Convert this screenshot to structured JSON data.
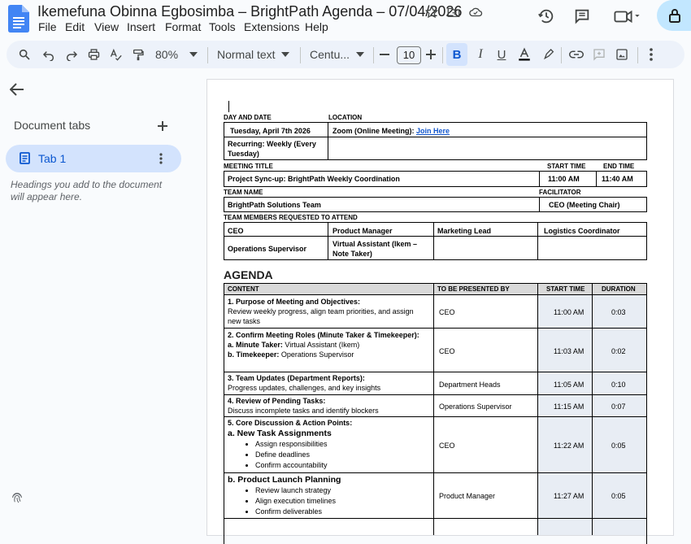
{
  "doc": {
    "title": "Ikemefuna Obinna Egbosimba – BrightPath Agenda – 07/04/2026",
    "menu": [
      "File",
      "Edit",
      "View",
      "Insert",
      "Format",
      "Tools",
      "Extensions",
      "Help"
    ]
  },
  "toolbar": {
    "zoom": "80%",
    "style": "Normal text",
    "font": "Centu...",
    "font_size": "10"
  },
  "sidebar": {
    "section_label": "Document tabs",
    "tab_label": "Tab 1",
    "hint": "Headings you add to the document will appear here."
  },
  "form": {
    "day_date_label": "DAY AND DATE",
    "location_label": "LOCATION",
    "date_value": "Tuesday, April 7th 2026",
    "location_value": "Zoom (Online Meeting):",
    "location_link": "Join Here",
    "recurring": "Recurring: Weekly (Every Tuesday)",
    "meeting_title_label": "MEETING TITLE",
    "start_time_label": "START TIME",
    "end_time_label": "END TIME",
    "meeting_title": "Project Sync-up: BrightPath Weekly Coordination",
    "start_time": "11:00 AM",
    "end_time": "11:40 AM",
    "team_name_label": "TEAM NAME",
    "facilitator_label": "FACILITATOR",
    "team_name": "BrightPath Solutions Team",
    "facilitator": "CEO (Meeting Chair)",
    "members_label": "TEAM MEMBERS REQUESTED TO ATTEND",
    "members": [
      "CEO",
      "Product Manager",
      "Marketing Lead",
      "Logistics Coordinator",
      "Operations Supervisor",
      "Virtual Assistant (Ikem – Note Taker)"
    ]
  },
  "agenda": {
    "heading": "AGENDA",
    "headers": [
      "CONTENT",
      "TO BE PRESENTED BY",
      "START TIME",
      "DURATION"
    ],
    "rows": [
      {
        "title": "1. Purpose of Meeting and Objectives:",
        "body": "Review weekly progress, align team priorities, and assign new tasks",
        "presenter": "CEO",
        "start": "11:00 AM",
        "duration": "0:03"
      },
      {
        "title": "2. Confirm Meeting Roles (Minute Taker & Timekeeper):",
        "a_label": "a.  Minute Taker:",
        "a_val": " Virtual Assistant (Ikem)",
        "b_label": "b.  Timekeeper:",
        "b_val": " Operations Supervisor",
        "presenter": "CEO",
        "start": "11:03 AM",
        "duration": "0:02"
      },
      {
        "title": "3. Team Updates (Department Reports):",
        "body": "Progress updates, challenges, and key insights",
        "presenter": "Department Heads",
        "start": "11:05 AM",
        "duration": "0:10"
      },
      {
        "title": "4. Review of Pending Tasks:",
        "body": "Discuss incomplete tasks and identify blockers",
        "presenter": "Operations Supervisor",
        "start": "11:15 AM",
        "duration": "0:07"
      },
      {
        "title": "5. Core Discussion & Action Points:",
        "sub": "a. New Task Assignments",
        "bullets": [
          "Assign responsibilities",
          "Define deadlines",
          "Confirm accountability"
        ],
        "presenter": "CEO",
        "start": "11:22 AM",
        "duration": "0:05"
      },
      {
        "sub": "b. Product Launch Planning",
        "bullets": [
          "Review launch strategy",
          "Align execution timelines",
          "Confirm deliverables"
        ],
        "presenter": "Product Manager",
        "start": "11:27 AM",
        "duration": "0:05"
      }
    ]
  }
}
